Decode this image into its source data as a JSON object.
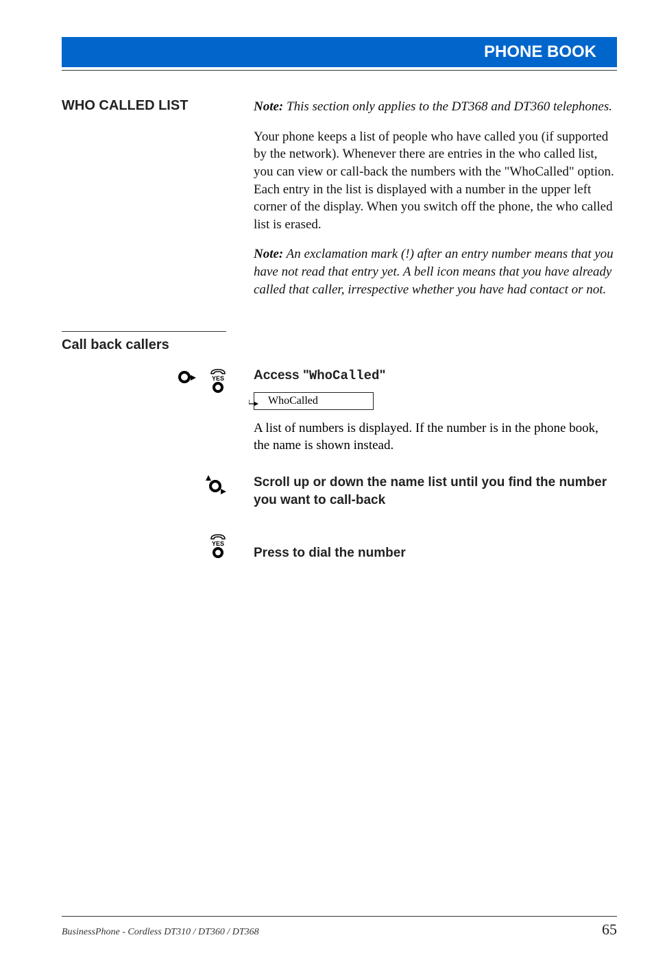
{
  "header": {
    "title": "PHONE BOOK"
  },
  "section": {
    "heading": "WHO CALLED LIST",
    "note1_label": "Note:",
    "note1_text": " This section only applies to the DT368 and DT360 telephones.",
    "para1": "Your phone keeps a list of people who have called you (if supported by the network). Whenever there are entries in the who called list, you can view or call-back the numbers with the \"WhoCalled\" option. Each entry in the list is displayed with a number in the upper left corner of the display. When you switch off the phone, the who called list is erased.",
    "note2_label": "Note:",
    "note2_text": " An exclamation mark (!) after an entry number means that you have not read that entry yet. A bell icon means that you have already called that caller, irrespective whether you have had contact or not."
  },
  "callback": {
    "subheading": "Call back callers",
    "step1_prefix": "Access \"",
    "step1_mono": "WhoCalled",
    "step1_suffix": "\"",
    "display_text": "WhoCalled",
    "step1_body": "A list of numbers is displayed. If the number is in the phone book, the name is shown instead.",
    "step2_heading": "Scroll up or down the name list until you find the number you want to call-back",
    "step3_heading": "Press to dial the number"
  },
  "footer": {
    "left": "BusinessPhone - Cordless DT310 / DT360 / DT368",
    "page": "65"
  }
}
